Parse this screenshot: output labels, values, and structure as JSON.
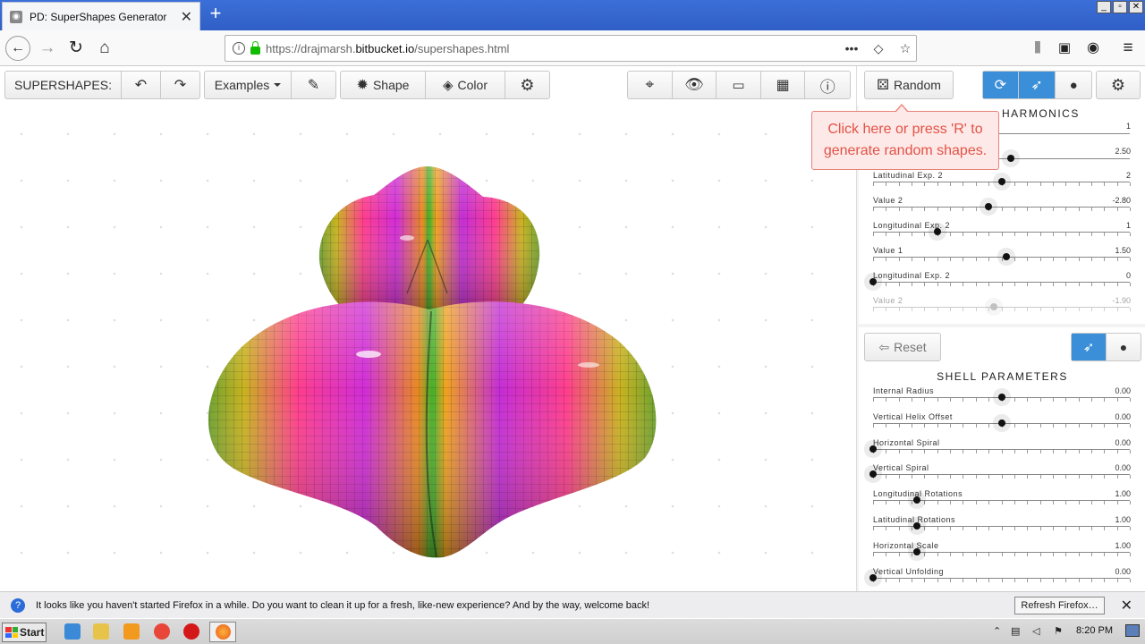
{
  "browser": {
    "tab_title": "PD: SuperShapes Generator",
    "url_prefix": "https://drajmarsh.",
    "url_host": "bitbucket.io",
    "url_path": "/supershapes.html",
    "window_buttons": [
      "_",
      "▫",
      "✕"
    ]
  },
  "toolbar": {
    "app_label": "SUPERSHAPES:",
    "examples_label": "Examples",
    "shape_label": "Shape",
    "color_label": "Color",
    "random_label": "Random"
  },
  "tooltip": {
    "text": "Click here or press 'R' to generate random shapes."
  },
  "harmonics": {
    "title": "HARMONICS",
    "first_value": "1",
    "second_value": "2.50",
    "sliders": [
      {
        "label": "Latitudinal Exp. 2",
        "value": "2",
        "fraction": 0.5,
        "dim": false
      },
      {
        "label": "Value 2",
        "value": "-2.80",
        "fraction": 0.45,
        "dim": false
      },
      {
        "label": "Longitudinal Exp. 2",
        "value": "1",
        "fraction": 0.25,
        "dim": false
      },
      {
        "label": "Value 1",
        "value": "1.50",
        "fraction": 0.52,
        "dim": false
      },
      {
        "label": "Longitudinal Exp. 2",
        "value": "0",
        "fraction": 0.0,
        "dim": false
      },
      {
        "label": "Value 2",
        "value": "-1.90",
        "fraction": 0.47,
        "dim": true
      }
    ]
  },
  "shell": {
    "reset_label": "Reset",
    "title": "SHELL PARAMETERS",
    "sliders": [
      {
        "label": "Internal Radius",
        "value": "0.00",
        "fraction": 0.5
      },
      {
        "label": "Vertical Helix Offset",
        "value": "0.00",
        "fraction": 0.5
      },
      {
        "label": "Horizontal Spiral",
        "value": "0.00",
        "fraction": 0.0
      },
      {
        "label": "Vertical Spiral",
        "value": "0.00",
        "fraction": 0.0
      },
      {
        "label": "Longitudinal Rotations",
        "value": "1.00",
        "fraction": 0.17
      },
      {
        "label": "Latitudinal Rotations",
        "value": "1.00",
        "fraction": 0.17
      },
      {
        "label": "Horizontal Scale",
        "value": "1.00",
        "fraction": 0.17
      },
      {
        "label": "Vertical Unfolding",
        "value": "0.00",
        "fraction": 0.0
      }
    ]
  },
  "notification": {
    "text": "It looks like you haven't started Firefox in a while. Do you want to clean it up for a fresh, like-new experience? And by the way, welcome back!",
    "button_label": "Refresh Firefox…"
  },
  "taskbar": {
    "start_label": "Start",
    "clock": "8:20 PM"
  },
  "colors": {
    "tooltip_text": "#e35247",
    "active_toggle": "#3b8fd8"
  }
}
